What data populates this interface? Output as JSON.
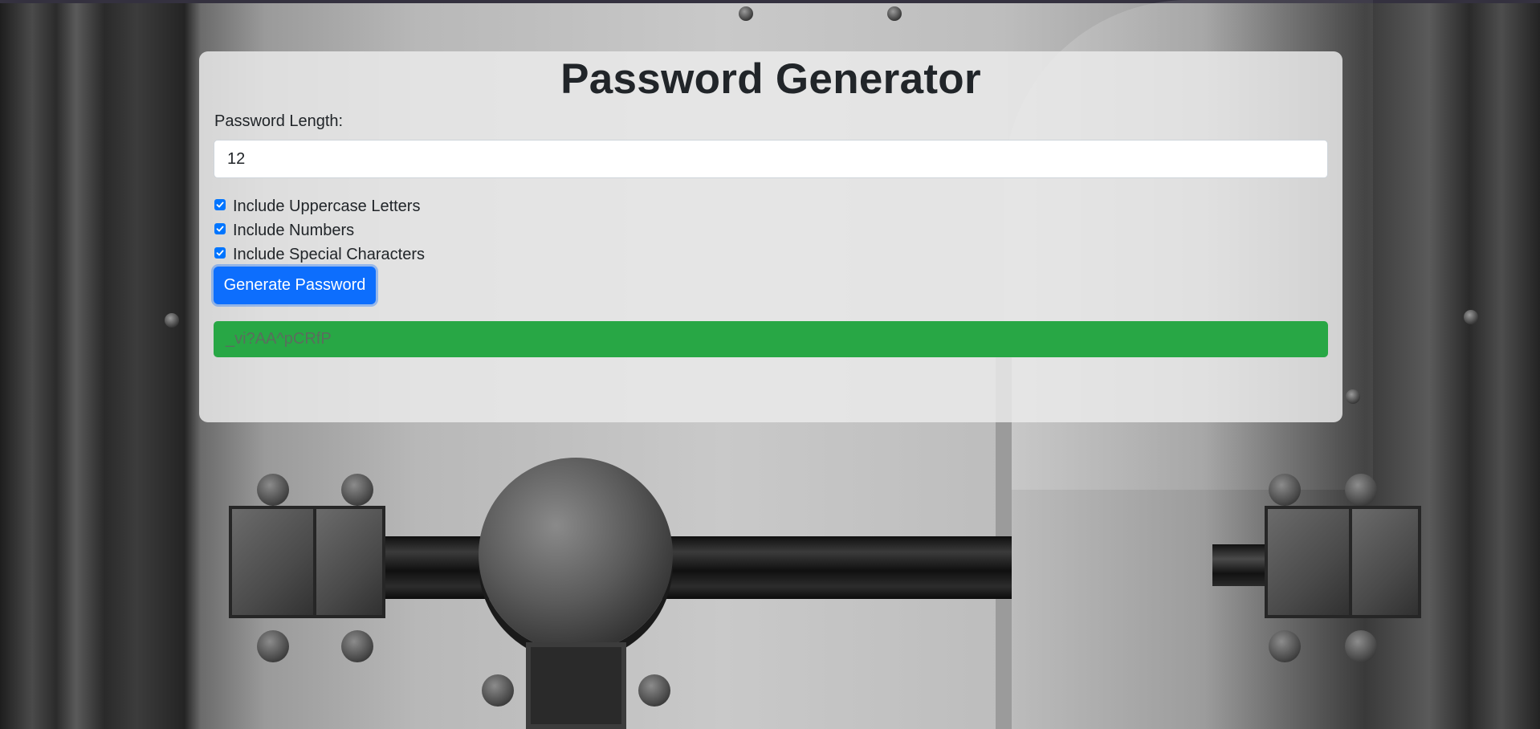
{
  "app": {
    "title": "Password Generator"
  },
  "form": {
    "length_label": "Password Length:",
    "length_value": "12",
    "options": [
      {
        "label": "Include Uppercase Letters",
        "checked": true
      },
      {
        "label": "Include Numbers",
        "checked": true
      },
      {
        "label": "Include Special Characters",
        "checked": true
      }
    ],
    "generate_label": "Generate Password"
  },
  "result": {
    "password": "_vi?AA^pCRfP"
  },
  "colors": {
    "primary": "#0d6efd",
    "success": "#28a745",
    "checkbox": "#0075ff",
    "text": "#212529"
  },
  "icons": {
    "checkbox": "check-icon"
  }
}
